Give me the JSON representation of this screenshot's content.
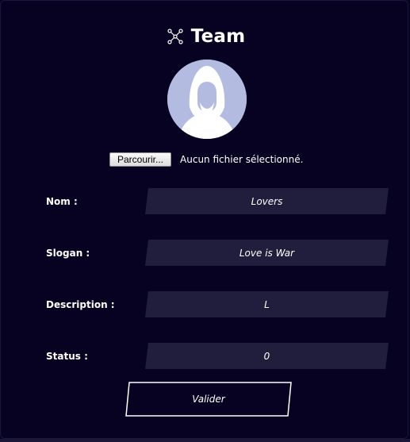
{
  "header": {
    "icon": "network-nodes-icon",
    "title": "Team"
  },
  "avatar": {
    "icon": "hooded-person-avatar"
  },
  "file_input": {
    "button_label": "Parcourir...",
    "status": "Aucun fichier sélectionné."
  },
  "fields": [
    {
      "label": "Nom :",
      "value": "Lovers"
    },
    {
      "label": "Slogan :",
      "value": "Love is War"
    },
    {
      "label": "Description :",
      "value": "L"
    },
    {
      "label": "Status :",
      "value": "0"
    }
  ],
  "submit": {
    "label": "Valider"
  },
  "colors": {
    "background": "#070222",
    "field_background": "#211e3d",
    "avatar_background": "#b4bbe0",
    "text": "#ffffff"
  }
}
